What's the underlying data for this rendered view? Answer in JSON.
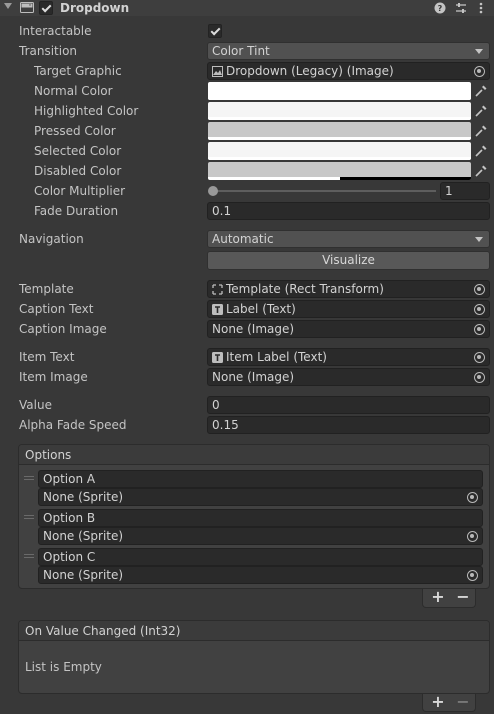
{
  "header": {
    "title": "Dropdown",
    "enabled": true,
    "icons": [
      "help-icon",
      "presets-icon",
      "more-icon"
    ]
  },
  "selectable": {
    "interactable_label": "Interactable",
    "interactable": true,
    "transition_label": "Transition",
    "transition_value": "Color Tint",
    "target_graphic_label": "Target Graphic",
    "target_graphic_value": "Dropdown (Legacy) (Image)",
    "normal_color_label": "Normal Color",
    "highlighted_color_label": "Highlighted Color",
    "pressed_color_label": "Pressed Color",
    "selected_color_label": "Selected Color",
    "disabled_color_label": "Disabled Color",
    "colors": {
      "normal": "#FFFFFF",
      "highlighted": "#F5F5F5",
      "pressed": "#C8C8C8",
      "selected": "#F5F5F5",
      "disabled": "#C8C8C8",
      "disabled_alpha": 0.5
    },
    "color_multiplier_label": "Color Multiplier",
    "color_multiplier_value": "1",
    "color_multiplier_level": 0.0,
    "fade_duration_label": "Fade Duration",
    "fade_duration_value": "0.1",
    "navigation_label": "Navigation",
    "navigation_value": "Automatic",
    "visualize_label": "Visualize"
  },
  "dropdown": {
    "template_label": "Template",
    "template_value": "Template (Rect Transform)",
    "caption_text_label": "Caption Text",
    "caption_text_value": "Label (Text)",
    "caption_image_label": "Caption Image",
    "caption_image_value": "None (Image)",
    "item_text_label": "Item Text",
    "item_text_value": "Item Label (Text)",
    "item_image_label": "Item Image",
    "item_image_value": "None (Image)",
    "value_label": "Value",
    "value_value": "0",
    "alpha_fade_label": "Alpha Fade Speed",
    "alpha_fade_value": "0.15"
  },
  "options": {
    "header": "Options",
    "items": [
      {
        "text": "Option A",
        "sprite": "None (Sprite)"
      },
      {
        "text": "Option B",
        "sprite": "None (Sprite)"
      },
      {
        "text": "Option C",
        "sprite": "None (Sprite)"
      }
    ],
    "add_label": "+",
    "remove_label": "−"
  },
  "event": {
    "header": "On Value Changed (Int32)",
    "empty_text": "List is Empty",
    "add_label": "+",
    "remove_label": "−"
  }
}
